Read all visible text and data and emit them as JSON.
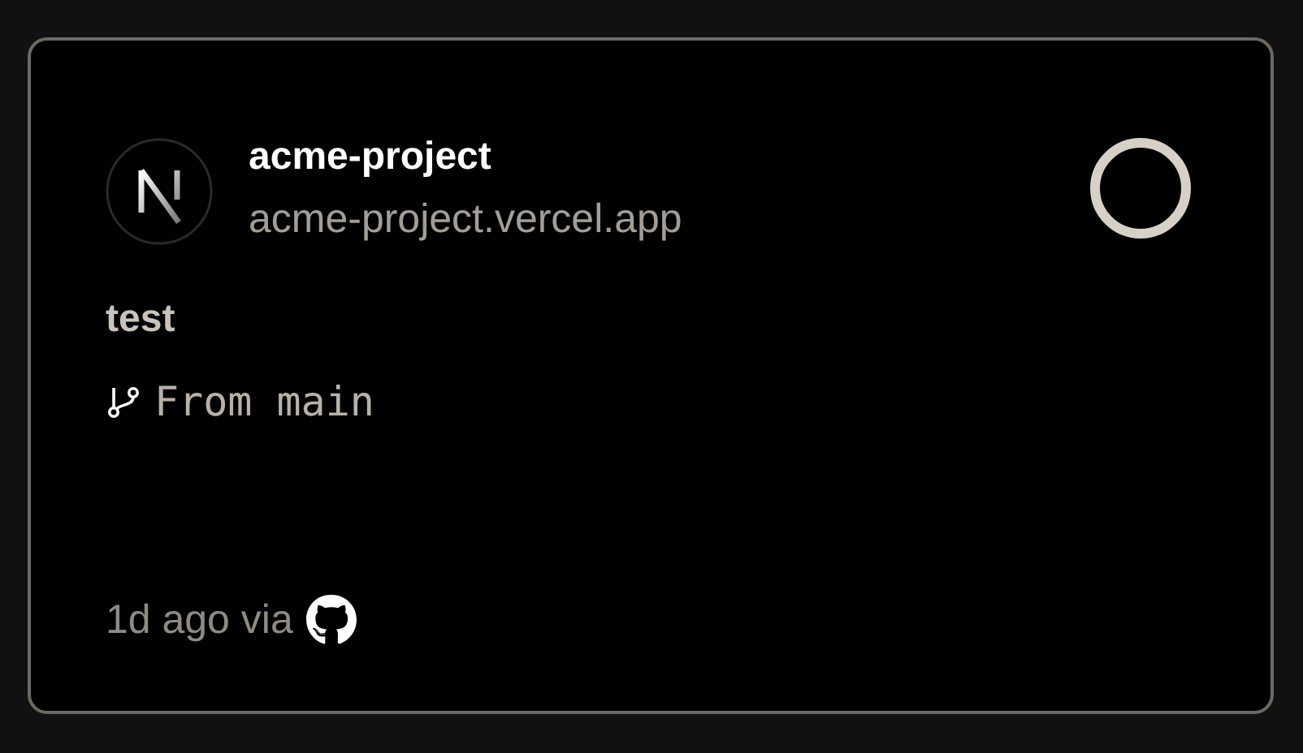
{
  "project": {
    "name": "acme-project",
    "url": "acme-project.vercel.app"
  },
  "deployment": {
    "message": "test",
    "branch": "From main",
    "time": "1d ago via"
  }
}
